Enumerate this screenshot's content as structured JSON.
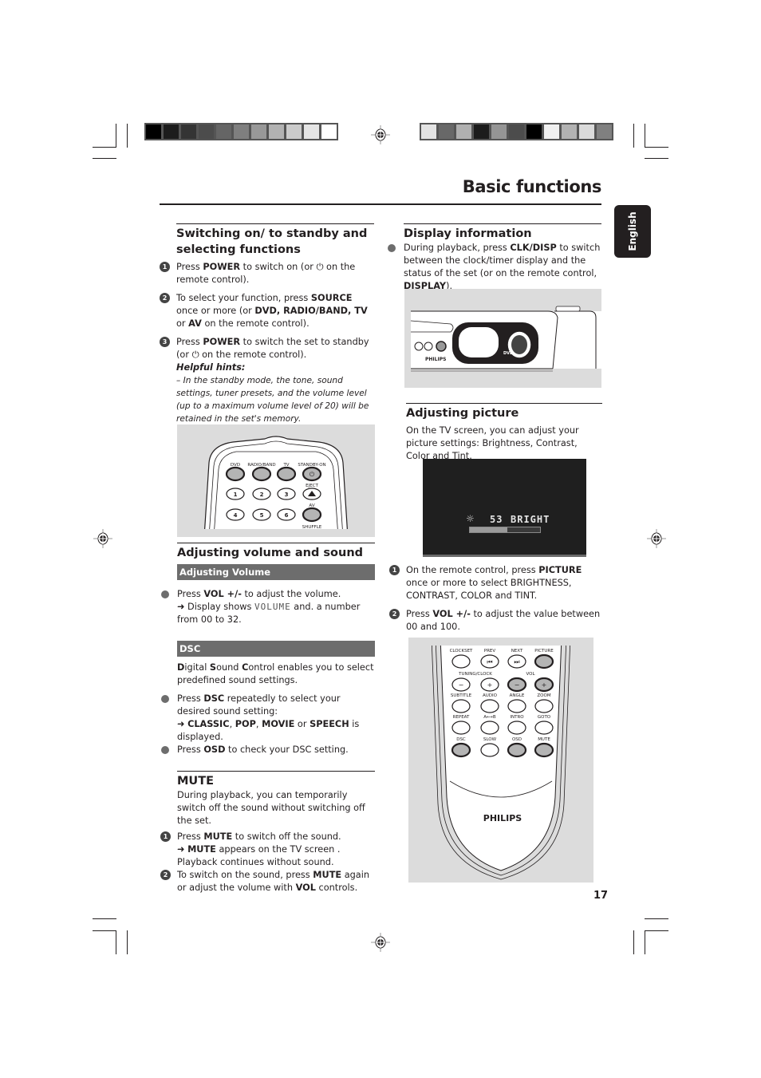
{
  "header": {
    "title": "Basic functions",
    "language_tab": "English"
  },
  "colorbars": {
    "left": [
      "#000000",
      "#1c1c1c",
      "#343434",
      "#4c4c4c",
      "#656565",
      "#7f7f7f",
      "#989898",
      "#b2b2b2",
      "#cbcbcb",
      "#e5e5e5",
      "#ffffff"
    ],
    "right": [
      "#e3e3e3",
      "#686868",
      "#b0b0b0",
      "#1c1c1c",
      "#959595",
      "#4c4c4c",
      "#000000",
      "#f0f0f0",
      "#b2b2b2",
      "#dadada",
      "#808080"
    ]
  },
  "switching": {
    "heading": "Switching on/ to standby and selecting functions",
    "steps": [
      {
        "num": "1",
        "parts": [
          "Press ",
          "POWER",
          " to switch on (or ",
          " on the remote control)."
        ]
      },
      {
        "num": "2",
        "parts": [
          "To select your function, press ",
          "SOURCE",
          " once or more (or ",
          "DVD, RADIO/BAND, TV",
          " or ",
          "AV",
          " on the remote control)."
        ]
      },
      {
        "num": "3",
        "parts": [
          "Press ",
          "POWER",
          " to switch the set to standby (or ",
          " on the remote control)."
        ]
      }
    ],
    "hints_title": "Helpful hints:",
    "hint": "–   In the standby mode, the tone, sound settings, tuner presets,  and the volume level (up to a maximum volume level of 20) will be retained in the set's memory."
  },
  "remote_top": {
    "labels": [
      "DVD",
      "RADIO/BAND",
      "TV",
      "STANDBY-ON"
    ],
    "eject": "EJECT",
    "av": "AV",
    "shuffle": "SHUFFLE",
    "numbers": [
      "1",
      "2",
      "3",
      "4",
      "5",
      "6"
    ]
  },
  "volume": {
    "heading": "Adjusting volume and sound",
    "sub_volume": "Adjusting Volume",
    "vol_parts": [
      "Press ",
      "VOL +/-",
      " to adjust the volume."
    ],
    "vol_result_prefix": "➜ Display shows ",
    "vol_lcd": "VOLUME",
    "vol_result_suffix": "  and. a number from 00 to 32.",
    "sub_dsc": "DSC",
    "dsc_intro": [
      "D",
      "igital ",
      "S",
      "ound ",
      "C",
      "ontrol enables you to select predefined sound settings."
    ],
    "dsc_step1": [
      "Press ",
      "DSC",
      " repeatedly to select your desired sound setting:"
    ],
    "dsc_result": [
      "➜ ",
      "CLASSIC",
      ", ",
      "POP",
      ", ",
      "MOVIE",
      " or ",
      "SPEECH",
      " is displayed."
    ],
    "dsc_step2": [
      "Press ",
      "OSD",
      " to check your DSC setting."
    ]
  },
  "mute": {
    "heading": "MUTE",
    "intro": "During playback,  you can temporarily switch off the sound without switching off the set.",
    "step1": [
      " Press ",
      "MUTE",
      " to switch off the sound."
    ],
    "step1_result": [
      "➜ ",
      "MUTE",
      " appears on the TV screen ."
    ],
    "step1_note": "Playback continues without sound.",
    "step2": [
      "To switch on the sound, press ",
      "MUTE",
      " again or adjust the volume with ",
      "VOL",
      " controls."
    ]
  },
  "display_info": {
    "heading": "Display information",
    "parts": [
      "During playback, press ",
      "CLK/DISP",
      " to switch between the clock/timer display and the status of the set (or on the remote control, ",
      "DISPLAY",
      ")."
    ],
    "device_brand": "PHILIPS"
  },
  "picture": {
    "heading": "Adjusting picture",
    "intro": "On the TV screen, you can adjust your picture settings:  Brightness, Contrast, Color and Tint.",
    "osd_value": "53",
    "osd_label": "BRIGHT",
    "osd_level": 0.53,
    "step1": [
      "On the remote control, press ",
      "PICTURE",
      " once or more to select BRIGHTNESS, CONTRAST, COLOR and TINT."
    ],
    "step2": [
      "Press ",
      "VOL +/-",
      " to adjust the value between 00 and 100."
    ]
  },
  "remote_bottom": {
    "row1": [
      "CLOCKSET",
      "PREV",
      "NEXT",
      "PICTURE"
    ],
    "row2_left": "TUNING/CLOCK",
    "row2_right": "VOL",
    "row3": [
      "SUBTITLE",
      "AUDIO",
      "ANGLE",
      "ZOOM"
    ],
    "row4": [
      "REPEAT",
      "A⟷B",
      "INTRO",
      "GOTO"
    ],
    "row5": [
      "DSC",
      "SLOW",
      "OSD",
      "MUTE"
    ],
    "brand": "PHILIPS"
  },
  "footer": {
    "page_number": "17"
  }
}
